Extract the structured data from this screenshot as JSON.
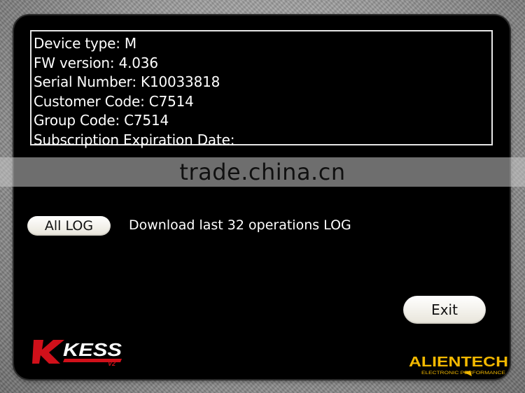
{
  "device_info": {
    "lines": [
      "Device type: M",
      "FW version: 4.036",
      "Serial Number: K10033818",
      "Customer Code: C7514",
      "Group Code: C7514",
      "Subscription Expiration Date:"
    ]
  },
  "watermark": "trade.china.cn",
  "log": {
    "button_label": "All LOG",
    "description": "Download last 32 operations LOG"
  },
  "exit_label": "Exit",
  "logos": {
    "kess": "KESS",
    "kess_version": "V2",
    "alientech": "ALIENTECH",
    "alientech_tagline": "ELECTRONIC PERFORMANCE"
  },
  "colors": {
    "panel": "#000000",
    "button": "#f3f1ea",
    "kess_red": "#d0101a",
    "alientech_yellow": "#f2b800"
  }
}
